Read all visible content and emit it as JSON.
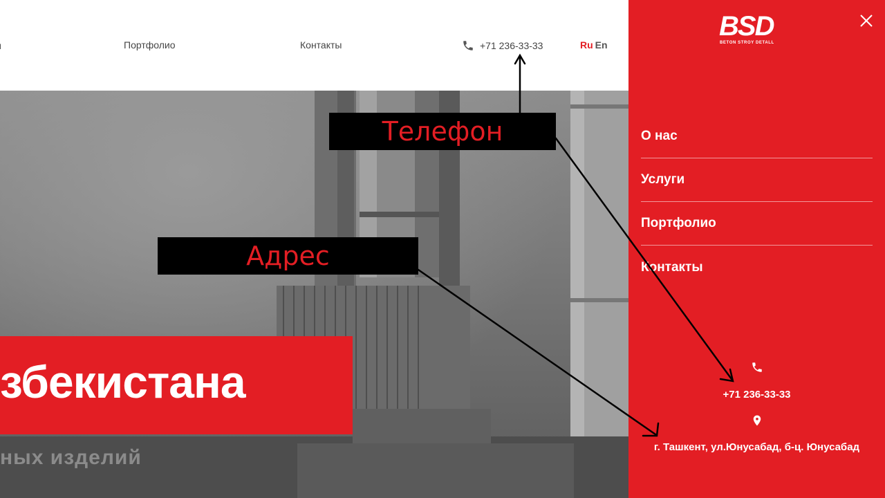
{
  "header": {
    "nav_fragment": "и",
    "nav": [
      "Портфолио",
      "Контакты"
    ],
    "phone": "+71 236-33-33",
    "lang_ru": "Ru",
    "lang_en": "En"
  },
  "hero": {
    "banner_title": "збекистана",
    "subtitle": "ных изделий"
  },
  "annotations": {
    "phone_label": "Телефон",
    "address_label": "Адрес"
  },
  "side_menu": {
    "logo_mark": "BSD",
    "logo_text": "BETON STROY DETALL",
    "items": [
      "О нас",
      "Услуги",
      "Портфолио",
      "Контакты"
    ],
    "phone": "+71 236-33-33",
    "address": "г. Ташкент, ул.Юнусабад, б-ц. Юнусабад"
  },
  "colors": {
    "accent": "#e31e24",
    "annotation_bg": "#000000"
  },
  "icons": [
    "phone-icon",
    "close-icon",
    "location-pin-icon"
  ]
}
